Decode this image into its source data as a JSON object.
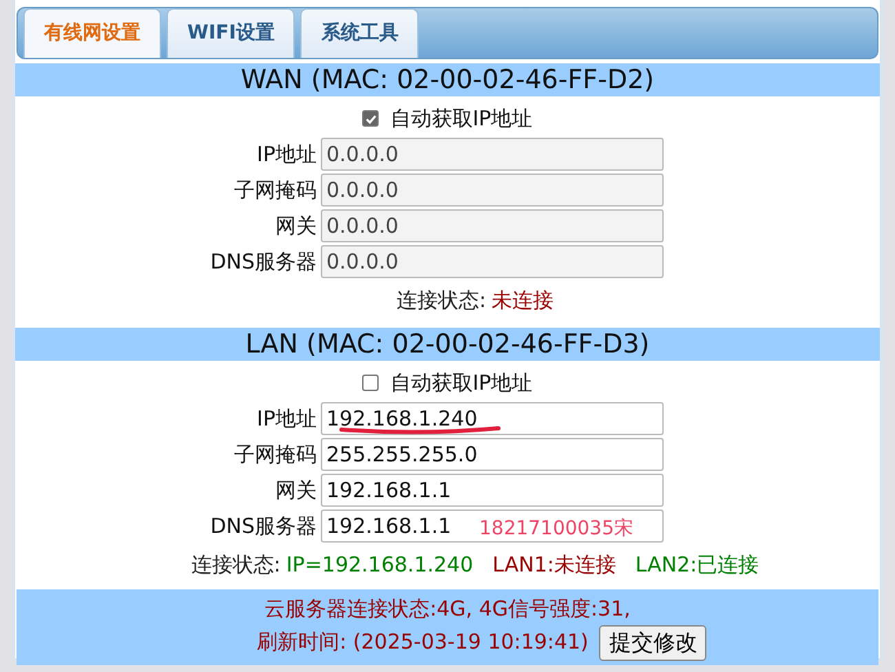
{
  "tabs": [
    {
      "label": "有线网设置",
      "selected": true
    },
    {
      "label": "WIFI设置",
      "selected": false
    },
    {
      "label": "系统工具",
      "selected": false
    }
  ],
  "sections": [
    {
      "title": "WAN (MAC: 02-00-02-46-FF-D2)",
      "auto_ip": {
        "label": "自动获取IP地址",
        "checked": true
      },
      "fields": [
        {
          "label": "IP地址",
          "value": "0.0.0.0",
          "disabled": true
        },
        {
          "label": "子网掩码",
          "value": "0.0.0.0",
          "disabled": true
        },
        {
          "label": "网关",
          "value": "0.0.0.0",
          "disabled": true
        },
        {
          "label": "DNS服务器",
          "value": "0.0.0.0",
          "disabled": true
        }
      ],
      "status": {
        "label": "连接状态:",
        "parts": [
          {
            "text": "未连接",
            "color": "#990000"
          }
        ]
      }
    },
    {
      "title": "LAN (MAC: 02-00-02-46-FF-D3)",
      "auto_ip": {
        "label": "自动获取IP地址",
        "checked": false
      },
      "fields": [
        {
          "label": "IP地址",
          "value": "192.168.1.240",
          "disabled": false,
          "underlined": true
        },
        {
          "label": "子网掩码",
          "value": "255.255.255.0",
          "disabled": false
        },
        {
          "label": "网关",
          "value": "192.168.1.1",
          "disabled": false
        },
        {
          "label": "DNS服务器",
          "value": "192.168.1.1",
          "disabled": false,
          "annotation": "18217100035宋"
        }
      ],
      "status": {
        "label": "连接状态:",
        "parts": [
          {
            "text": "IP=192.168.1.240",
            "color": "#008000"
          },
          {
            "text": "LAN1:未连接",
            "color": "#990000"
          },
          {
            "text": "LAN2:已连接",
            "color": "#008000"
          }
        ]
      }
    }
  ],
  "footer": {
    "cloud_status": "云服务器连接状态:4G, 4G信号强度:31,",
    "refresh_time": "刷新时间: (2025-03-19 10:19:41)",
    "submit": "提交修改"
  }
}
